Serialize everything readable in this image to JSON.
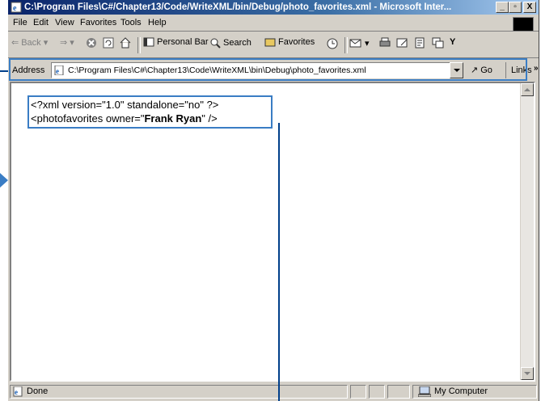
{
  "window": {
    "title": "C:\\Program Files\\C#/Chapter13/Code/WriteXML/bin/Debug/photo_favorites.xml - Microsoft Inter...",
    "controls": {
      "minimize": "_",
      "maximize": "▫",
      "close": "X"
    }
  },
  "menu": [
    "File",
    "Edit",
    "View",
    "Favorites",
    "Tools",
    "Help"
  ],
  "toolbar": {
    "back": "Back",
    "personal_bar": "Personal Bar",
    "search": "Search",
    "favorites": "Favorites"
  },
  "address": {
    "label": "Address",
    "value": "C:\\Program Files\\C#\\Chapter13\\Code\\WriteXML\\bin\\Debug\\photo_favorites.xml",
    "go": "Go",
    "links": "Links"
  },
  "document": {
    "line1": "<?xml version=\"1.0\" standalone=\"no\" ?>",
    "line2_open": "<photofavorites owner=\"",
    "owner": "Frank Ryan",
    "line2_close": "\" />"
  },
  "status": {
    "text": "Done",
    "zone": "My Computer"
  },
  "colors": {
    "title_start": "#0a246a",
    "title_end": "#a6caf0",
    "callout": "#3a7dc4",
    "leader": "#003f8a"
  }
}
